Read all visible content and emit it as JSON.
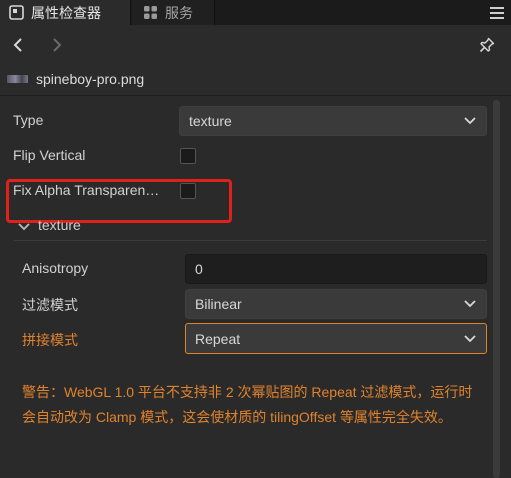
{
  "tabs": [
    {
      "label": "属性检查器",
      "icon": "inspector-icon",
      "active": true
    },
    {
      "label": "服务",
      "icon": "services-icon",
      "active": false
    }
  ],
  "asset": {
    "name": "spineboy-pro.png",
    "icon": "image-thumbnail-icon"
  },
  "properties": {
    "type": {
      "label": "Type",
      "value": "texture"
    },
    "flip_vertical": {
      "label": "Flip Vertical",
      "checked": false
    },
    "fix_alpha": {
      "label": "Fix Alpha Transparen…",
      "checked": false
    }
  },
  "section": {
    "title": "texture",
    "anisotropy": {
      "label": "Anisotropy",
      "value": "0"
    },
    "filter_mode": {
      "label": "过滤模式",
      "value": "Bilinear"
    },
    "wrap_mode": {
      "label": "拼接模式",
      "value": "Repeat"
    }
  },
  "warning": "警告：WebGL 1.0 平台不支持非 2 次幂贴图的 Repeat 过滤模式，运行时会自动改为 Clamp 模式，这会使材质的 tilingOffset 等属性完全失效。",
  "colors": {
    "warning": "#e1832d",
    "highlight": "#e0201a",
    "accent": "#e1832d"
  }
}
